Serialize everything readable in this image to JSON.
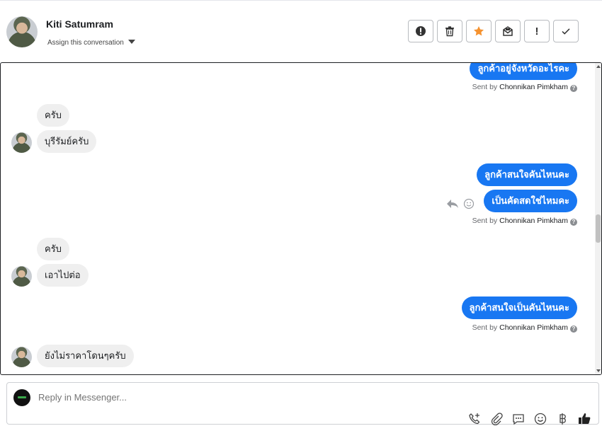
{
  "header": {
    "contact_name": "Kiti Satumram",
    "assign_label": "Assign this conversation",
    "toolbar": [
      {
        "name": "spam-button",
        "icon": "alert-circle-icon"
      },
      {
        "name": "delete-button",
        "icon": "trash-icon"
      },
      {
        "name": "star-button",
        "icon": "star-icon",
        "color": "#f5922f"
      },
      {
        "name": "mark-unread-button",
        "icon": "envelope-icon"
      },
      {
        "name": "follow-up-button",
        "icon": "exclamation-icon",
        "label": "!"
      },
      {
        "name": "done-button",
        "icon": "check-icon"
      }
    ]
  },
  "messages": [
    {
      "dir": "out",
      "text": "ลูกค้าอยู่จังหวัดอะไรคะ"
    },
    {
      "dir": "in",
      "text": "ครับ"
    },
    {
      "dir": "in",
      "text": "บุรีรัมย์ครับ"
    },
    {
      "dir": "out",
      "text": "ลูกค้าสนใจคันไหนคะ"
    },
    {
      "dir": "out",
      "text": "เป็นคัดสดใช่ไหมคะ"
    },
    {
      "dir": "in",
      "text": "ครับ"
    },
    {
      "dir": "in",
      "text": "เอาไปต่อ"
    },
    {
      "dir": "out",
      "text": "ลูกค้าสนใจเป็นคันไหนคะ"
    },
    {
      "dir": "in",
      "text": "ยังไม่ราคาโดนๆครับ"
    }
  ],
  "sent_by": {
    "prefix": "Sent by",
    "agent": "Chonnikan Pimkham"
  },
  "reply": {
    "placeholder": "Reply in Messenger..."
  },
  "colors": {
    "outgoing_bubble": "#1877f2",
    "incoming_bubble": "#efefef"
  }
}
